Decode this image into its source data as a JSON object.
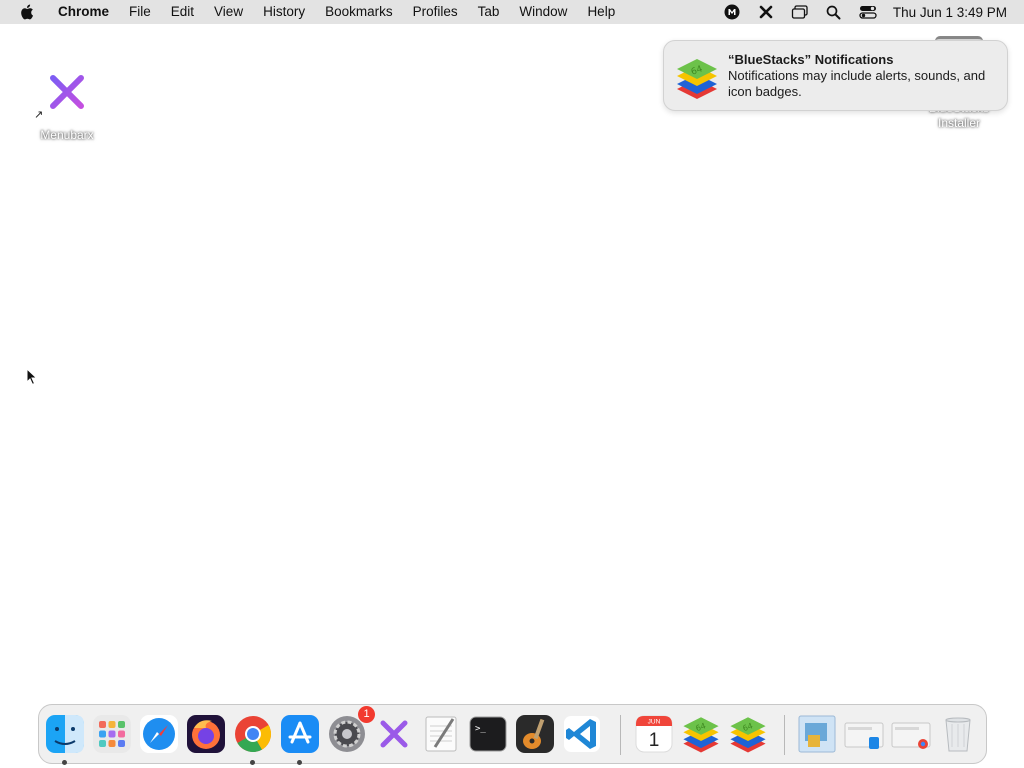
{
  "menubar": {
    "app_name": "Chrome",
    "items": [
      "File",
      "Edit",
      "View",
      "History",
      "Bookmarks",
      "Profiles",
      "Tab",
      "Window",
      "Help"
    ],
    "clock": "Thu Jun 1  3:49 PM"
  },
  "desktop": {
    "icons": [
      {
        "label": "Menubarx"
      },
      {
        "label": "BlueStacks Installer"
      }
    ]
  },
  "notification": {
    "title": "“BlueStacks” Notifications",
    "body": "Notifications may include alerts, sounds, and icon badges.",
    "icon_text": "64"
  },
  "dock": {
    "apps": [
      {
        "name": "Finder",
        "icon": "finder-icon",
        "running": true
      },
      {
        "name": "Launchpad",
        "icon": "launchpad-icon",
        "running": false
      },
      {
        "name": "Safari",
        "icon": "safari-icon",
        "running": false
      },
      {
        "name": "Firefox",
        "icon": "firefox-icon",
        "running": false
      },
      {
        "name": "Google Chrome",
        "icon": "chrome-icon",
        "running": true
      },
      {
        "name": "App Store",
        "icon": "app-store-icon",
        "running": true
      },
      {
        "name": "System Preferences",
        "icon": "system-preferences-icon",
        "running": false,
        "badge": "1"
      },
      {
        "name": "Menubarx",
        "icon": "menubarx-icon",
        "running": false
      },
      {
        "name": "TextEdit",
        "icon": "textedit-icon",
        "running": false
      },
      {
        "name": "Terminal",
        "icon": "terminal-icon",
        "running": false
      },
      {
        "name": "GarageBand",
        "icon": "garageband-icon",
        "running": false
      },
      {
        "name": "Visual Studio Code",
        "icon": "vscode-icon",
        "running": false
      }
    ],
    "calendar": {
      "month": "JUN",
      "day": "1"
    },
    "bluestacks_text": "64",
    "terminal_prompt": ">_"
  },
  "colors": {
    "menubar_bg": "#e3e3e3",
    "badge": "#f23a2f",
    "notification_bg": "#ececec"
  }
}
